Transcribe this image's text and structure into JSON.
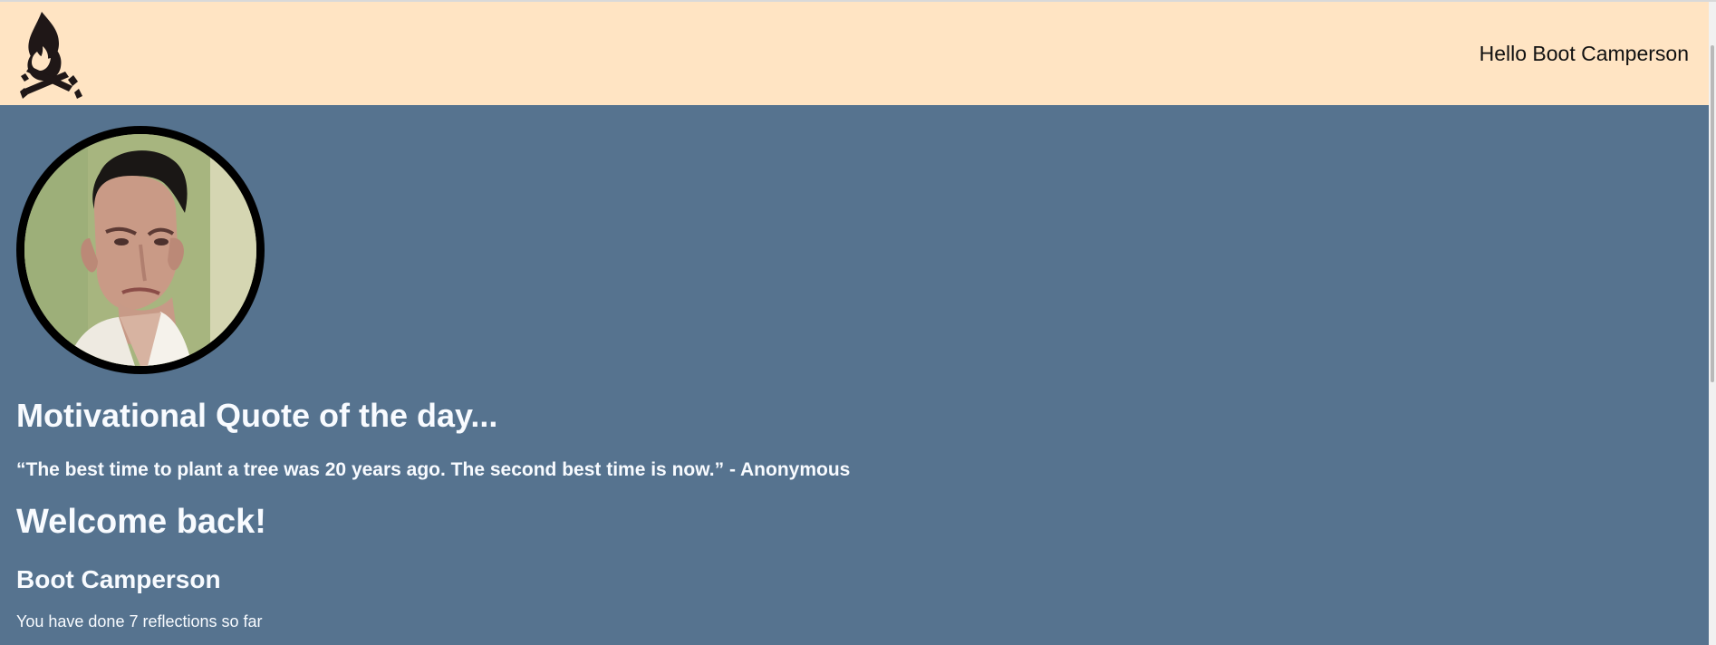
{
  "header": {
    "logo_icon": "campfire-icon",
    "greeting": "Hello Boot Camperson"
  },
  "profile": {
    "avatar_alt": "profile-photo"
  },
  "main": {
    "quote_title": "Motivational Quote of the day...",
    "quote_text": "“The best time to plant a tree was 20 years ago. The second best time is now.” - Anonymous",
    "welcome": "Welcome back!",
    "user_name": "Boot Camperson",
    "reflections": "You have done 7 reflections so far"
  },
  "colors": {
    "header_bg": "#ffe4c3",
    "page_bg": "#56738f",
    "text_light": "#f8fbff",
    "text_dark": "#111111"
  }
}
